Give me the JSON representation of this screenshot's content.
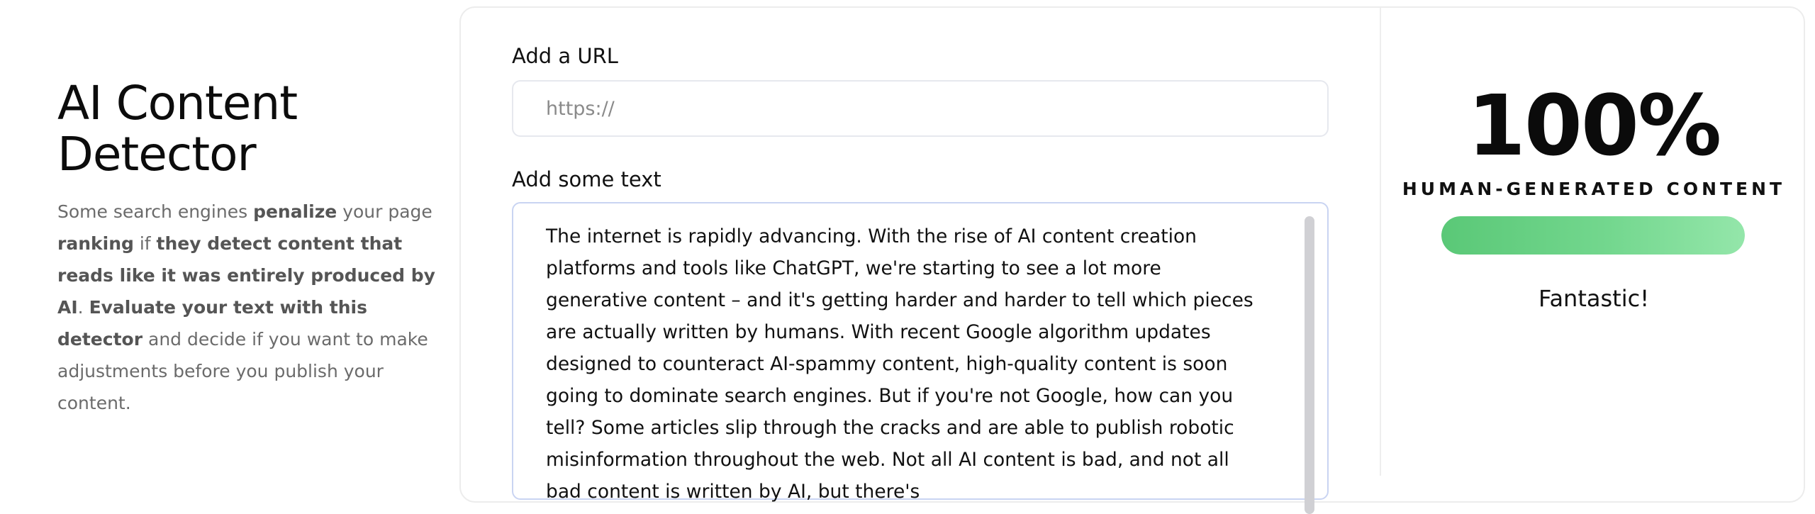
{
  "intro": {
    "title_line1": "AI Content",
    "title_line2": "Detector",
    "desc": {
      "t1": "Some search engines ",
      "b1": "penalize",
      "t2": " your page ",
      "b2": "ranking",
      "t3": " if ",
      "b3": "they detect content that reads like it was entirely produced by AI",
      "t4": ". ",
      "b4": "Evaluate your text with this detector",
      "t5": " and decide if you want to make adjustments before you publish your content."
    }
  },
  "form": {
    "url_label": "Add a URL",
    "url_placeholder": "https://",
    "url_value": "",
    "text_label": "Add some text",
    "text_value": "The internet is rapidly advancing. With the rise of AI content creation platforms and tools like ChatGPT, we're starting to see a lot more generative content – and it's getting harder and harder to tell which pieces are actually written by humans. With recent Google algorithm updates designed to counteract AI-spammy content, high-quality content is soon going to dominate search engines. But if you're not Google, how can you tell? Some articles slip through the cracks and are able to publish robotic misinformation throughout the web. Not all AI content is bad, and not all bad content is written by AI, but there's"
  },
  "result": {
    "score": "100%",
    "score_label": "HUMAN-GENERATED CONTENT",
    "human_fraction": 1.0,
    "verdict": "Fantastic!",
    "bar_color": "#5ac877"
  }
}
